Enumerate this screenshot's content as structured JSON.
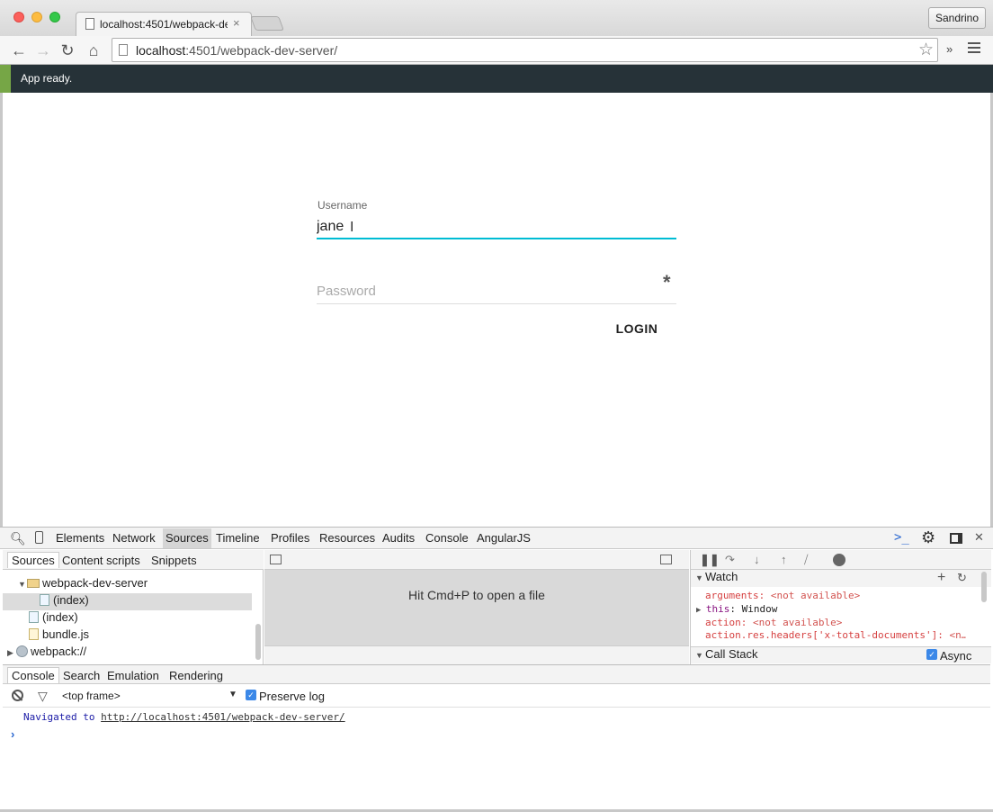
{
  "browser": {
    "tab_title": "localhost:4501/webpack-dev-server/",
    "tab_close": "×",
    "profile_name": "Sandrino",
    "address_host": "localhost",
    "address_rest": ":4501/webpack-dev-server/",
    "icons": {
      "back": "←",
      "forward": "→",
      "reload": "↻",
      "home": "⌂",
      "star": "☆",
      "extensions": "»"
    }
  },
  "app": {
    "status_message": "App ready.",
    "accent_color": "#00bcd4",
    "username_label": "Username",
    "username_value": "jane",
    "password_placeholder": "Password",
    "required_marker": "*",
    "login_label": "LOGIN"
  },
  "devtools": {
    "tabs": [
      "Elements",
      "Network",
      "Sources",
      "Timeline",
      "Profiles",
      "Resources",
      "Audits",
      "Console",
      "AngularJS"
    ],
    "active_tab": "Sources",
    "navigator": {
      "tabs": [
        "Sources",
        "Content scripts",
        "Snippets"
      ],
      "tree": [
        {
          "label": "webpack-dev-server"
        },
        {
          "label": "(index)"
        },
        {
          "label": "(index)"
        },
        {
          "label": "bundle.js"
        },
        {
          "label": "webpack://"
        }
      ]
    },
    "editor_hint": "Hit Cmd+P to open a file",
    "watch": {
      "title": "Watch",
      "add": "+",
      "refresh": "↻",
      "items": [
        {
          "name": "arguments",
          "value": "<not available>"
        },
        {
          "name": "this",
          "value": "Window"
        },
        {
          "name": "action",
          "value": "<not available>"
        },
        {
          "name": "action.res.headers['x-total-documents']",
          "value": "<n…"
        }
      ]
    },
    "call_stack_title": "Call Stack",
    "async_label": "Async",
    "console_tabs": [
      "Console",
      "Search",
      "Emulation",
      "Rendering"
    ],
    "frame_select": "<top frame>",
    "preserve_log_label": "Preserve log",
    "console_message_prefix": "Navigated to",
    "console_message_url": "http://localhost:4501/webpack-dev-server/",
    "prompt": "›"
  }
}
